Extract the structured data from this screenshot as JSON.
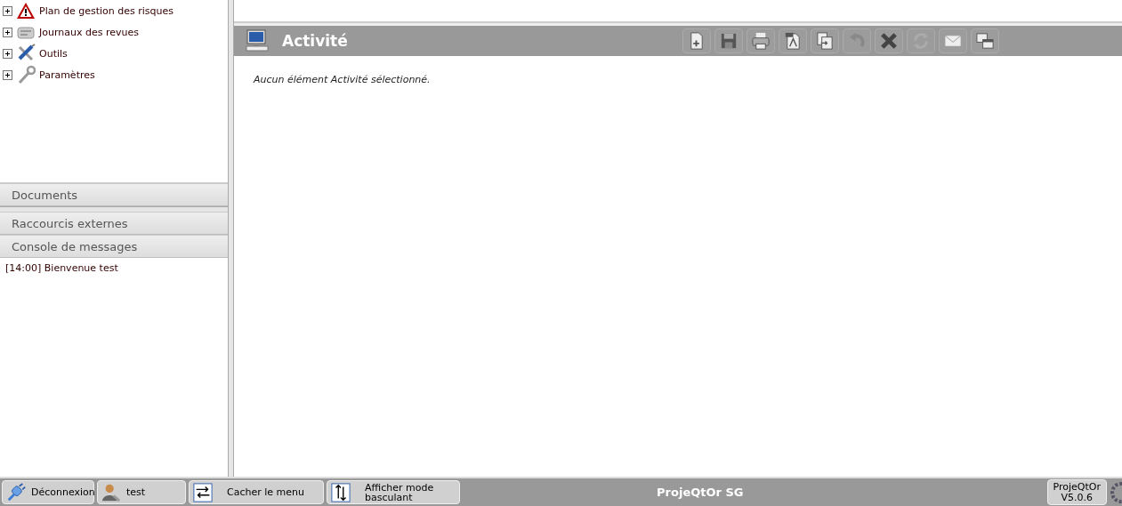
{
  "menu_tree": [
    {
      "label": "Plan de gestion des risques",
      "expanded": false,
      "kind": "warning"
    },
    {
      "label": "Journaux des revues",
      "expanded": false,
      "kind": "papers"
    },
    {
      "label": "Outils",
      "expanded": false,
      "kind": "tools"
    },
    {
      "label": "Paramètres",
      "expanded": false,
      "kind": "wrench"
    }
  ],
  "accordion_top": [
    "Documents"
  ],
  "accordion_bottom": [
    "Raccourcis externes",
    "Console de messages"
  ],
  "messages": [
    "[14:00] Bienvenue test"
  ],
  "detail": {
    "title": "Activité",
    "empty_message": "Aucun élément Activité sélectionné.",
    "toolbar": [
      {
        "kind": "new",
        "disabled": false
      },
      {
        "kind": "save",
        "disabled": false
      },
      {
        "kind": "print",
        "disabled": false
      },
      {
        "kind": "pdf",
        "disabled": false
      },
      {
        "kind": "copy",
        "disabled": false
      },
      {
        "kind": "undo",
        "disabled": true
      },
      {
        "kind": "delete",
        "disabled": false
      },
      {
        "kind": "refresh",
        "disabled": true
      },
      {
        "kind": "mail",
        "disabled": false
      },
      {
        "kind": "multi",
        "disabled": false
      }
    ]
  },
  "bottom_bar": {
    "buttons": [
      {
        "kind": "logout",
        "label": "Déconnexion"
      },
      {
        "kind": "user",
        "label": "test"
      },
      {
        "kind": "hide",
        "label": "Cacher le menu"
      },
      {
        "kind": "switch",
        "label": "Afficher mode basculant"
      }
    ],
    "app_title": "ProjeQtOr SG",
    "version_name": "ProjeQtOr",
    "version": "V5.0.6"
  }
}
